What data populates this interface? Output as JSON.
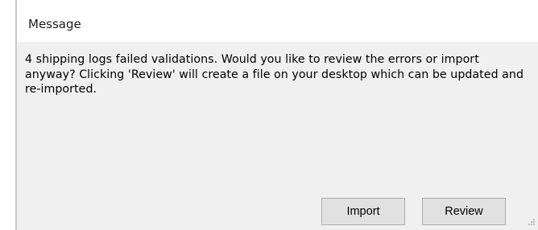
{
  "dialog": {
    "title": "Message",
    "message": "4 shipping logs failed validations. Would you like to review the errors or import anyway? Clicking 'Review' will create a file on your desktop which can be updated and re-imported.",
    "buttons": {
      "import_label": "Import",
      "review_label": "Review"
    }
  },
  "colors": {
    "body_background": "#f0f0f0",
    "titlebar_background": "#ffffff",
    "button_background": "#e1e1e1",
    "button_border": "#adadad"
  },
  "icons": {
    "resize_grip": "size-grip-icon"
  }
}
